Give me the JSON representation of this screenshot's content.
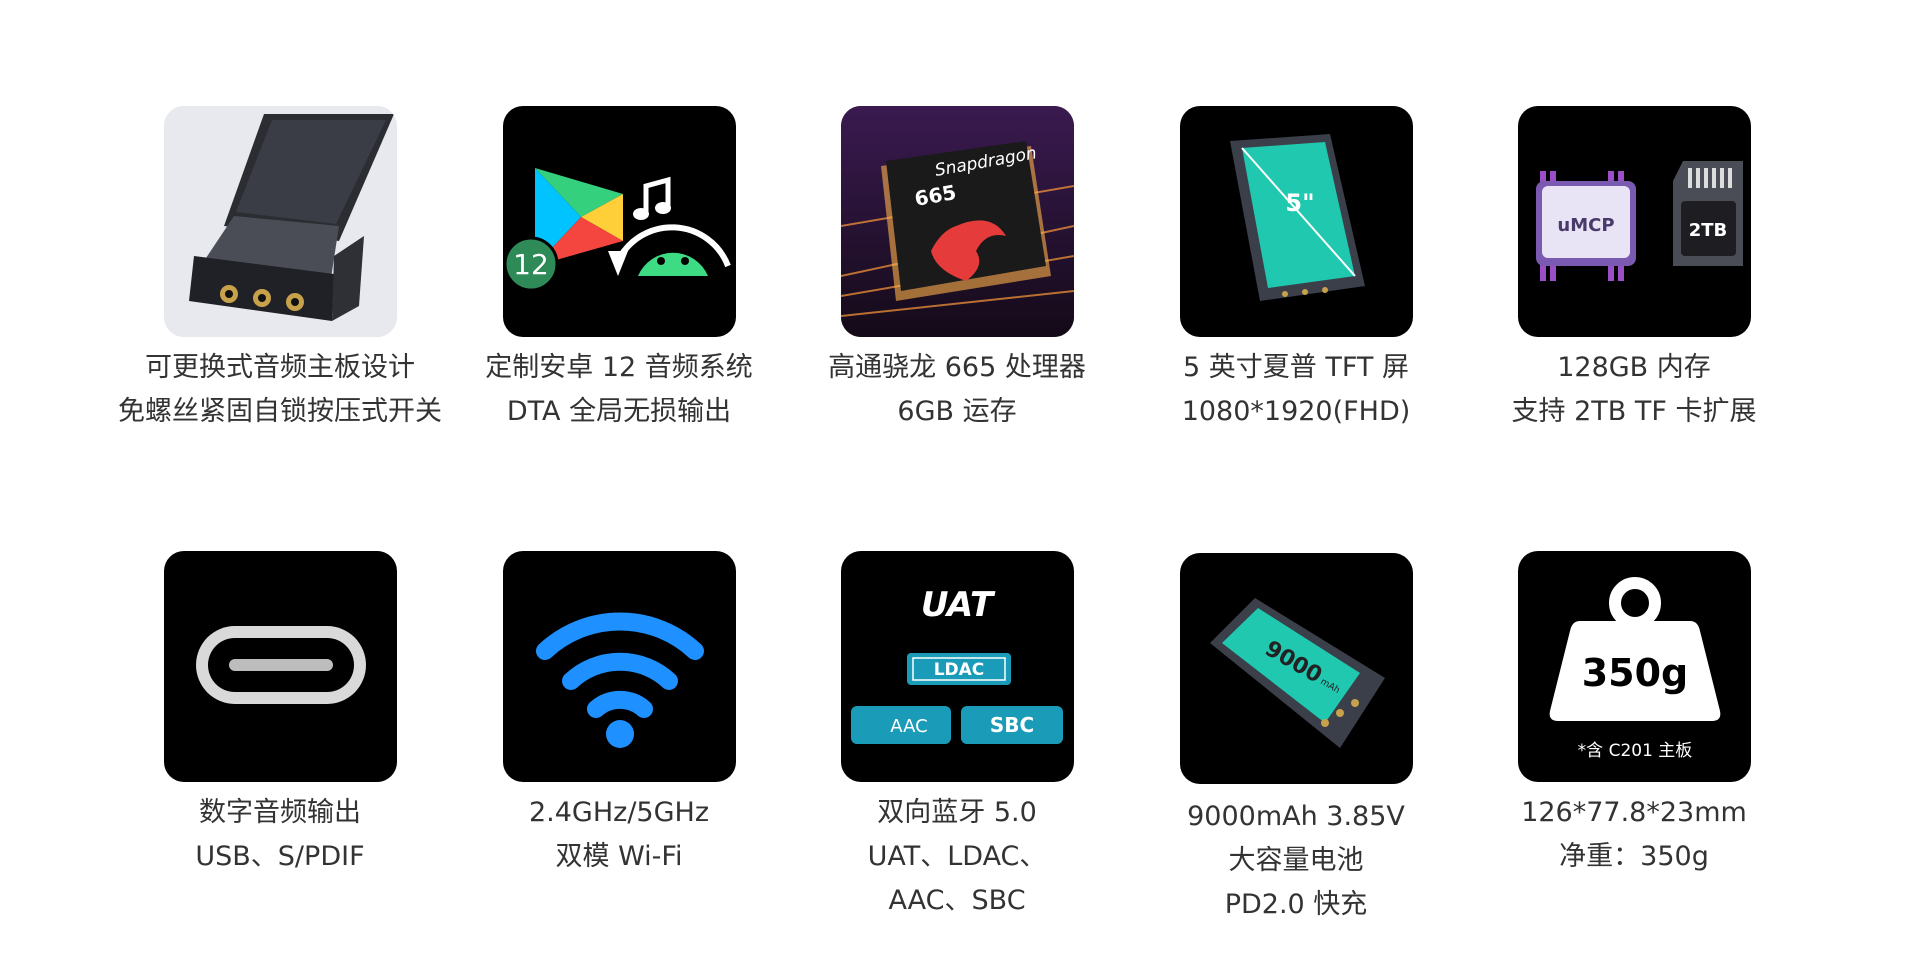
{
  "features": [
    {
      "id": "mainboard",
      "icon": "replaceable-mainboard-image",
      "lines": [
        "可更换式音频主板设计",
        "免螺丝紧固自锁按压式开关"
      ]
    },
    {
      "id": "android",
      "icon": "android-12-play-icon",
      "badge": "12",
      "lines": [
        "定制安卓 12 音频系统",
        "DTA 全局无损输出"
      ]
    },
    {
      "id": "chip",
      "icon": "snapdragon-chip-image",
      "chip_text": "Snapdragon",
      "chip_model": "665",
      "lines": [
        "高通骁龙 665 处理器",
        "6GB 运存"
      ]
    },
    {
      "id": "screen",
      "icon": "screen-size-image",
      "size_label": "5\"",
      "lines": [
        "5 英寸夏普 TFT 屏",
        "1080*1920(FHD)"
      ]
    },
    {
      "id": "storage",
      "icon": "storage-chips-image",
      "chip_label": "uMCP",
      "card_label": "2TB",
      "lines": [
        "128GB 内存",
        "支持 2TB TF 卡扩展"
      ]
    },
    {
      "id": "digital-out",
      "icon": "usb-c-port-icon",
      "lines": [
        "数字音频输出",
        "USB、S/PDIF"
      ]
    },
    {
      "id": "wifi",
      "icon": "wifi-icon",
      "lines": [
        "2.4GHz/5GHz",
        "双模 Wi-Fi"
      ]
    },
    {
      "id": "bluetooth",
      "icon": "bluetooth-codecs-icon",
      "codecs": {
        "uat": "UAT",
        "ldac": "LDAC",
        "aac": "AAC",
        "sbc": "SBC"
      },
      "lines": [
        "双向蓝牙 5.0",
        "UAT、LDAC、",
        "AAC、SBC"
      ]
    },
    {
      "id": "battery",
      "icon": "battery-device-image",
      "battery_value": "9000",
      "battery_unit": "mAh",
      "lines": [
        "9000mAh 3.85V",
        "大容量电池",
        "PD2.0 快充"
      ]
    },
    {
      "id": "weight",
      "icon": "weight-icon",
      "weight_label": "350g",
      "weight_note": "*含 C201 主板",
      "lines": [
        "126*77.8*23mm",
        "净重：350g"
      ]
    }
  ],
  "colors": {
    "tile_bg": "#000000",
    "caption": "#333333",
    "wifi": "#1e90ff",
    "codec_teal": "#1a9cb8",
    "android_green": "#3ddc84"
  }
}
